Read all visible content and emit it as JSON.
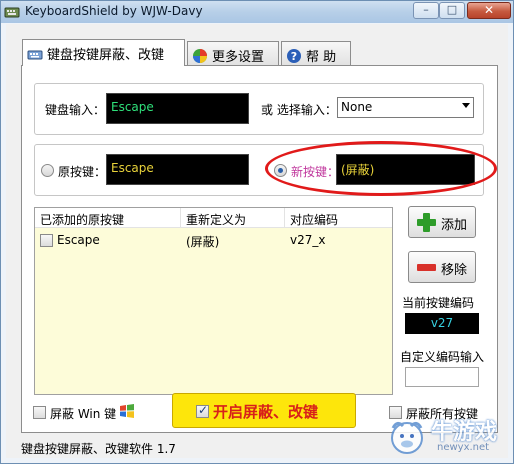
{
  "window": {
    "title": "KeyboardShield by WJW-Davy",
    "min": "–",
    "max": "□",
    "close": "✕"
  },
  "tabs": [
    {
      "label": "键盘按键屏蔽、改键",
      "active": true,
      "icon": "keyboard-icon"
    },
    {
      "label": "更多设置",
      "active": false,
      "icon": "settings-ball-icon"
    },
    {
      "label": "帮  助",
      "active": false,
      "icon": "help-icon"
    }
  ],
  "input_group": {
    "label": "键盘输入：",
    "value": "Escape",
    "or_label": "或  选择输入：",
    "select_value": "None"
  },
  "keys_group": {
    "original_label": "原按键：",
    "original_value": "Escape",
    "new_label": "新按键：",
    "new_value": "(屏蔽)",
    "selected": "new"
  },
  "list": {
    "headers": [
      "已添加的原按键",
      "重新定义为",
      "对应编码"
    ],
    "rows": [
      {
        "key": "Escape",
        "remap": "(屏蔽)",
        "code": "v27_x",
        "checked": false
      }
    ]
  },
  "buttons": {
    "add": "添加",
    "remove": "移除"
  },
  "code": {
    "current_label": "当前按键编码",
    "current_value": "v27",
    "custom_label": "自定义编码输入",
    "custom_value": ""
  },
  "bottom": {
    "win_label": "屏蔽 Win 键",
    "enable_label": "开启屏蔽、改键",
    "enable_checked": true,
    "all_label": "屏蔽所有按键"
  },
  "status": "键盘按键屏蔽、改键软件 1.7",
  "watermark": {
    "brand": "牛游戏",
    "site": "newyx.net"
  },
  "colors": {
    "input_text": "#2fe07a",
    "key_text": "#e8d23a",
    "code_text": "#37d1e0",
    "enable_bg": "#fde60b",
    "enable_text": "#d8201a",
    "highlight": "#e11a1a"
  }
}
